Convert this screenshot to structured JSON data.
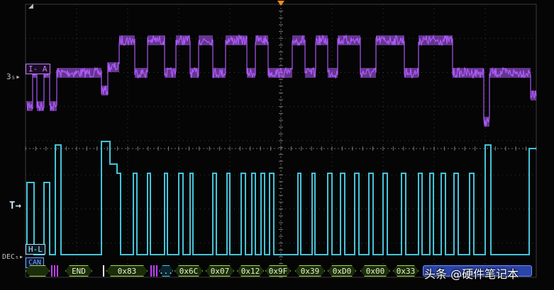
{
  "channels": {
    "ch3": {
      "tag": "I- A",
      "level_label": "3₅",
      "color": "#c77dff"
    },
    "trigger": {
      "level_label": "T"
    },
    "bus": {
      "tag": "H-L",
      "dec_label": "DEC₅",
      "decoder": "CAN",
      "color": "#46c3d9"
    }
  },
  "decode": {
    "frames": [
      {
        "kind": "hex",
        "label": ""
      },
      {
        "kind": "marker",
        "label": ""
      },
      {
        "kind": "hex",
        "label": "END"
      },
      {
        "kind": "marker-w",
        "label": ""
      },
      {
        "kind": "hex",
        "label": "0x83"
      },
      {
        "kind": "marker",
        "label": ""
      },
      {
        "kind": "ellipsis",
        "label": "..."
      },
      {
        "kind": "hex",
        "label": "0x6C"
      },
      {
        "kind": "hex",
        "label": "0x07"
      },
      {
        "kind": "hex",
        "label": "0x12"
      },
      {
        "kind": "hex",
        "label": "0x9F"
      },
      {
        "kind": "hex",
        "label": "0x39"
      },
      {
        "kind": "hex",
        "label": "0xD0"
      },
      {
        "kind": "hex",
        "label": "0x00"
      },
      {
        "kind": "hex",
        "label": "0x33"
      },
      {
        "kind": "tail",
        "label": ""
      }
    ]
  },
  "watermark": "头条 @硬件笔记本",
  "colors": {
    "grid": "#3a3a3a",
    "ch3": "#b25cff",
    "bus": "#46c3d9",
    "trigger": "#ff8a1c"
  }
}
